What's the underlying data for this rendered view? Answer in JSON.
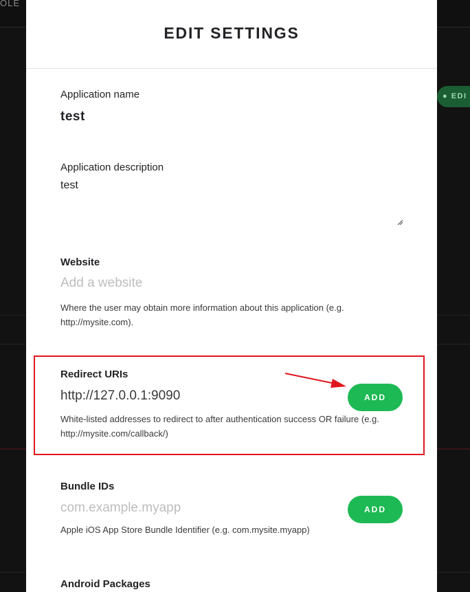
{
  "background": {
    "topbar_text": "OLE",
    "edit_button": "EDI"
  },
  "modal": {
    "title": "EDIT SETTINGS",
    "app_name": {
      "label": "Application name",
      "value": "test"
    },
    "app_description": {
      "label": "Application description",
      "value": "test"
    },
    "website": {
      "label": "Website",
      "placeholder": "Add a website",
      "help": "Where the user may obtain more information about this application (e.g. http://mysite.com)."
    },
    "redirect_uris": {
      "label": "Redirect URIs",
      "value": "http://127.0.0.1:9090",
      "add_label": "ADD",
      "help": "White-listed addresses to redirect to after authentication success OR failure (e.g. http://mysite.com/callback/)"
    },
    "bundle_ids": {
      "label": "Bundle IDs",
      "placeholder": "com.example.myapp",
      "add_label": "ADD",
      "help": "Apple iOS App Store Bundle Identifier (e.g. com.mysite.myapp)"
    },
    "android_packages": {
      "label": "Android Packages"
    }
  },
  "colors": {
    "accent_green": "#1db954",
    "annotation_red": "#e0161e",
    "overlay": "#121212"
  }
}
